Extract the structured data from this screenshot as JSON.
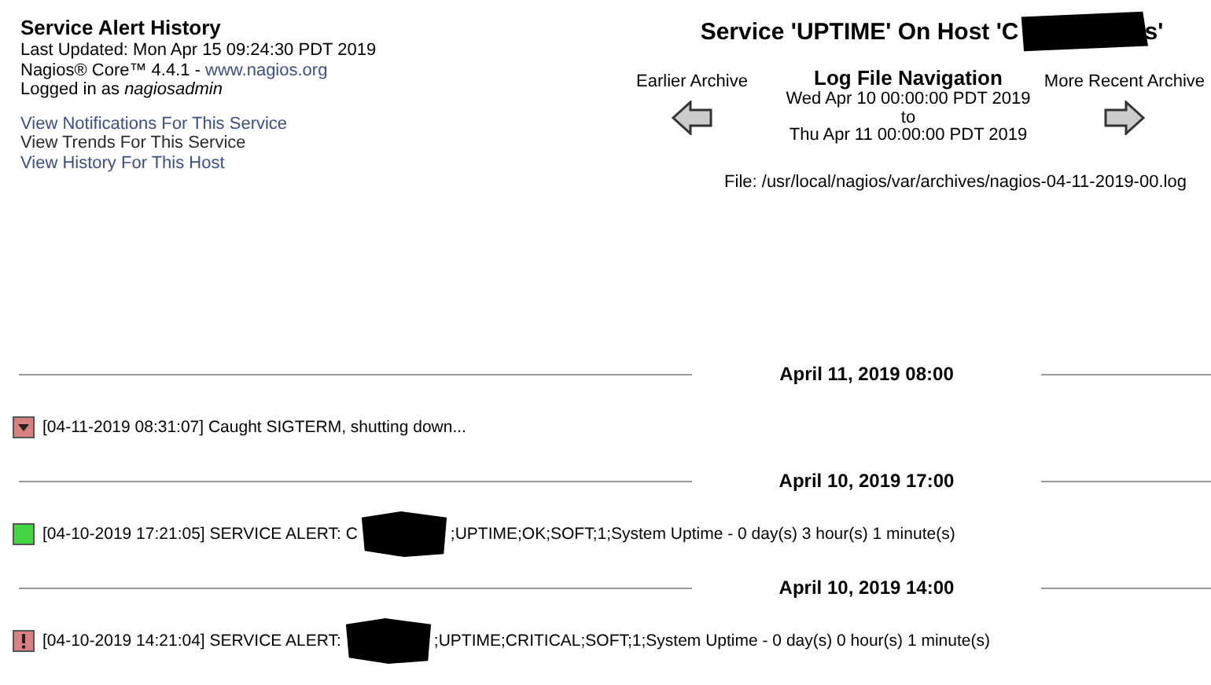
{
  "header": {
    "title": "Service Alert History",
    "last_updated": "Last Updated: Mon Apr 15 09:24:30 PDT 2019",
    "version_text": "Nagios® Core™ 4.4.1 - ",
    "version_link": "www.nagios.org",
    "logged_in_prefix": "Logged in as ",
    "user": "nagiosadmin",
    "links": [
      "View Notifications For This Service",
      "View Trends For This Service",
      "View History For This Host"
    ]
  },
  "page_title": {
    "before": "Service 'UPTIME' On Host 'C",
    "after": "s'"
  },
  "navigation": {
    "earlier": "Earlier Archive",
    "title": "Log File Navigation",
    "from": "Wed Apr 10 00:00:00 PDT 2019",
    "to_word": "to",
    "to": "Thu Apr 11 00:00:00 PDT 2019",
    "later": "More Recent Archive",
    "file": "File: /usr/local/nagios/var/archives/nagios-04-11-2019-00.log"
  },
  "groups": [
    {
      "heading": "April 11, 2019 08:00",
      "entries": [
        {
          "kind": "stop",
          "before": "[04-11-2019 08:31:07] Caught SIGTERM, shutting down...",
          "redacted": false
        }
      ]
    },
    {
      "heading": "April 10, 2019 17:00",
      "entries": [
        {
          "kind": "ok",
          "before": "[04-10-2019 17:21:05] SERVICE ALERT: C",
          "redacted": true,
          "after": ";UPTIME;OK;SOFT;1;System Uptime - 0 day(s) 3 hour(s) 1 minute(s)"
        }
      ]
    },
    {
      "heading": "April 10, 2019 14:00",
      "entries": [
        {
          "kind": "critical",
          "before": "[04-10-2019 14:21:04] SERVICE ALERT:",
          "redacted": true,
          "after": ";UPTIME;CRITICAL;SOFT;1;System Uptime - 0 day(s) 0 hour(s) 1 minute(s)"
        }
      ]
    }
  ]
}
